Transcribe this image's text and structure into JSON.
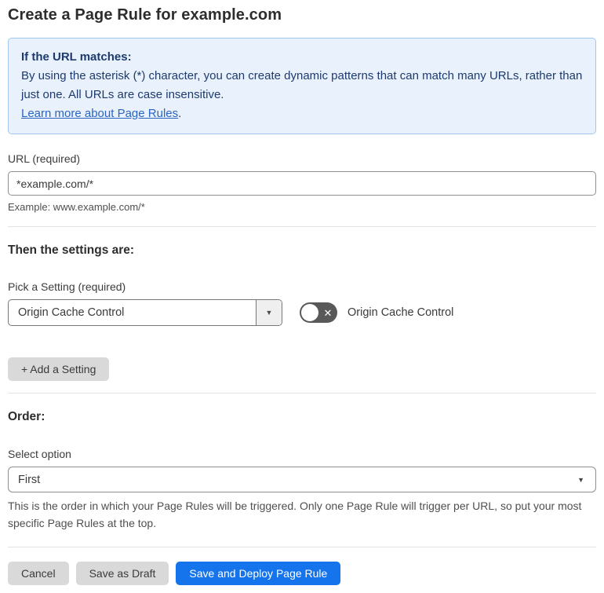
{
  "page": {
    "title": "Create a Page Rule for example.com"
  },
  "info_box": {
    "heading": "If the URL matches:",
    "body": "By using the asterisk (*) character, you can create dynamic patterns that can match many URLs, rather than just one. All URLs are case insensitive.",
    "link_label": "Learn more about Page Rules",
    "link_suffix": "."
  },
  "url_field": {
    "label": "URL (required)",
    "value": "*example.com/*",
    "helper": "Example: www.example.com/*"
  },
  "settings_section": {
    "heading": "Then the settings are:",
    "picker_label": "Pick a Setting (required)",
    "selected_setting": "Origin Cache Control",
    "toggle_label": "Origin Cache Control",
    "toggle_state": "off",
    "add_setting_label": "+ Add a Setting"
  },
  "order_section": {
    "heading": "Order:",
    "select_label": "Select option",
    "selected_option": "First",
    "helper": "This is the order in which your Page Rules will be triggered. Only one Page Rule will trigger per URL, so put your most specific Page Rules at the top."
  },
  "footer": {
    "cancel_label": "Cancel",
    "save_draft_label": "Save as Draft",
    "save_deploy_label": "Save and Deploy Page Rule"
  },
  "icons": {
    "caret_down": "▼",
    "toggle_x": "✕"
  },
  "colors": {
    "info_bg": "#e9f2fc",
    "info_border": "#9fc7ee",
    "info_text": "#1d3a6e",
    "link": "#2a64c5",
    "primary_button": "#1573eb",
    "toggle_off": "#595959",
    "gray_button": "#d9d9d9"
  }
}
